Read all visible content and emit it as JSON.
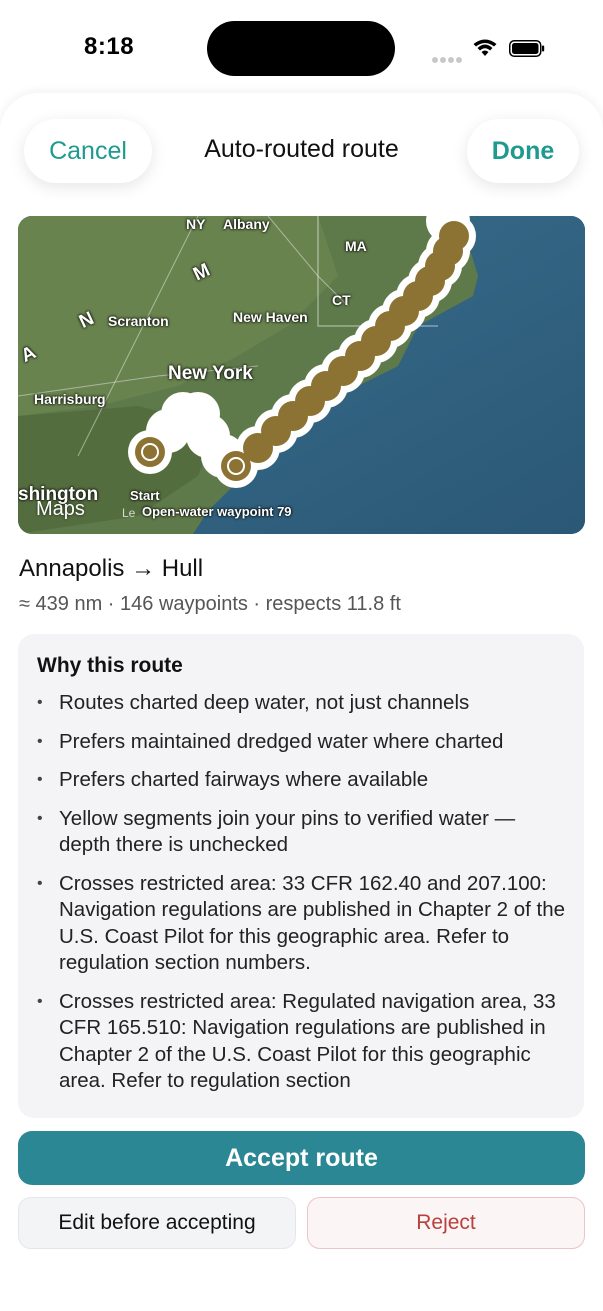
{
  "status": {
    "time": "8:18"
  },
  "header": {
    "cancel_label": "Cancel",
    "title": "Auto-routed route",
    "done_label": "Done"
  },
  "map": {
    "labels": {
      "ny": "NY",
      "albany": "Albany",
      "ma": "MA",
      "m": "M",
      "ct": "CT",
      "scranton": "Scranton",
      "new_haven": "New Haven",
      "new_york": "New York",
      "harrisburg": "Harrisburg",
      "washington": "shington",
      "start": "Start",
      "waypoint": "Open-water waypoint 79",
      "a": "A",
      "n": "N"
    },
    "attribution": "Maps",
    "legal": "Le"
  },
  "route": {
    "title": "Annapolis → Hull",
    "summary": "≈ 439 nm · 146 waypoints · respects 11.8 ft"
  },
  "why": {
    "heading": "Why this route",
    "items": [
      "Routes charted deep water, not just channels",
      "Prefers maintained dredged water where charted",
      "Prefers charted fairways where available",
      "Yellow segments join your pins to verified water — depth there is unchecked",
      "Crosses restricted area: 33 CFR 162.40 and 207.100: Navigation regulations are published in Chapter 2 of the U.S. Coast Pilot for this geographic area. Refer to regulation section numbers.",
      "Crosses restricted area: Regulated navigation area, 33 CFR 165.510: Navigation regulations are published in Chapter 2 of the U.S. Coast Pilot for this geographic area. Refer to regulation section"
    ]
  },
  "actions": {
    "accept_label": "Accept route",
    "edit_label": "Edit before accepting",
    "reject_label": "Reject"
  },
  "colors": {
    "accent": "#1f9a8f",
    "primary_button": "#2b8794",
    "reject": "#b9403b",
    "pin": "#8d7333"
  }
}
